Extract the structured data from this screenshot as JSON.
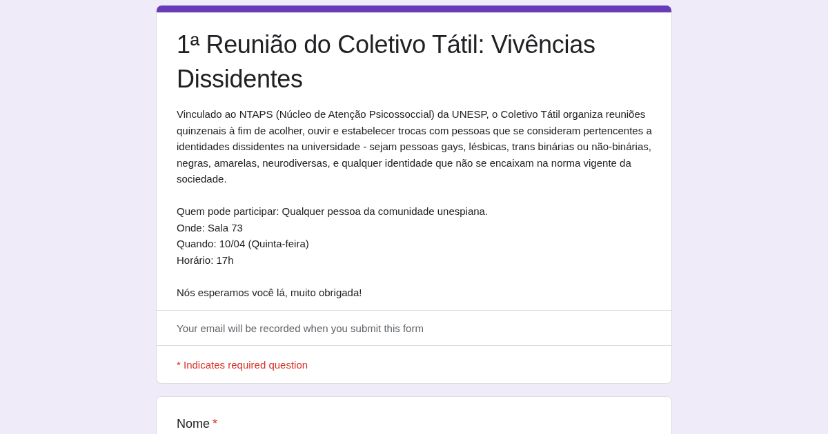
{
  "form": {
    "title": "1ª Reunião do Coletivo Tátil: Vivências Dissidentes",
    "description": [
      "Vinculado ao NTAPS (Núcleo de Atenção Psicossoccial) da UNESP, o Coletivo Tátil organiza reuniões quinzenais à fim de acolher, ouvir e estabelecer trocas com pessoas que se consideram pertencentes a identidades dissidentes na universidade - sejam pessoas gays, lésbicas, trans binárias ou não-binárias, negras, amarelas, neurodiversas, e qualquer identidade que não se encaixam na norma vigente da sociedade.",
      "Quem pode participar: Qualquer pessoa da comunidade unespiana.\nOnde: Sala 73\nQuando: 10/04 (Quinta-feira)\nHorário: 17h",
      "Nós esperamos você lá, muito obrigada!"
    ],
    "email_notice": "Your email will be recorded when you submit this form",
    "required_notice": "* Indicates required question"
  },
  "questions": [
    {
      "label": "Nome",
      "required": true,
      "required_mark": "*"
    }
  ]
}
